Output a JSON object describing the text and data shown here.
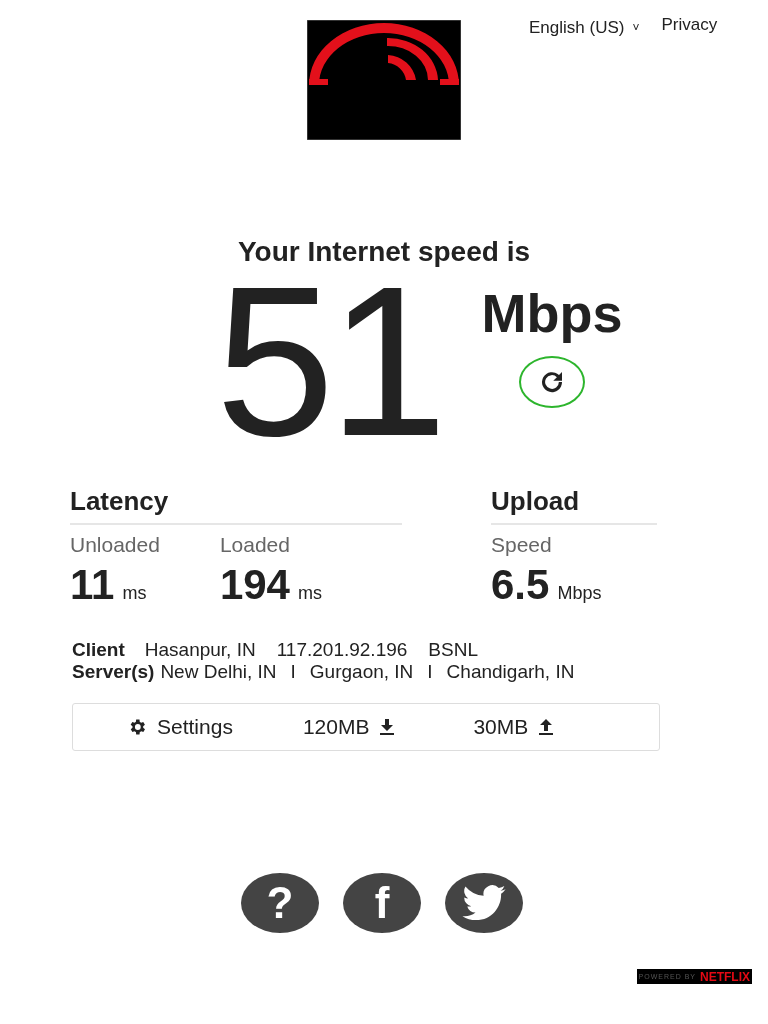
{
  "header": {
    "language": "English (US)",
    "chevron": "˅",
    "privacy": "Privacy"
  },
  "speed": {
    "heading": "Your Internet speed is",
    "value": "51",
    "unit": "Mbps"
  },
  "latency": {
    "title": "Latency",
    "items": [
      {
        "label": "Unloaded",
        "value": "11",
        "unit": "ms"
      },
      {
        "label": "Loaded",
        "value": "194",
        "unit": "ms"
      }
    ]
  },
  "upload": {
    "title": "Upload",
    "items": [
      {
        "label": "Speed",
        "value": "6.5",
        "unit": "Mbps"
      }
    ]
  },
  "client": {
    "label": "Client",
    "parts": [
      "Hasanpur, IN",
      "117.201.92.196",
      "BSNL"
    ]
  },
  "servers": {
    "label": "Server(s)",
    "parts": [
      "New Delhi, IN",
      "I",
      "Gurgaon, IN",
      "I",
      "Chandigarh, IN"
    ]
  },
  "settings_bar": {
    "settings": "Settings",
    "download_size": "120MB",
    "upload_size": "30MB"
  },
  "social": [
    {
      "kind": "help",
      "glyph": "?"
    },
    {
      "kind": "facebook",
      "glyph": "f"
    },
    {
      "kind": "twitter"
    }
  ],
  "badge": {
    "prefix": "POWERED BY",
    "brand": "NETFLIX"
  }
}
